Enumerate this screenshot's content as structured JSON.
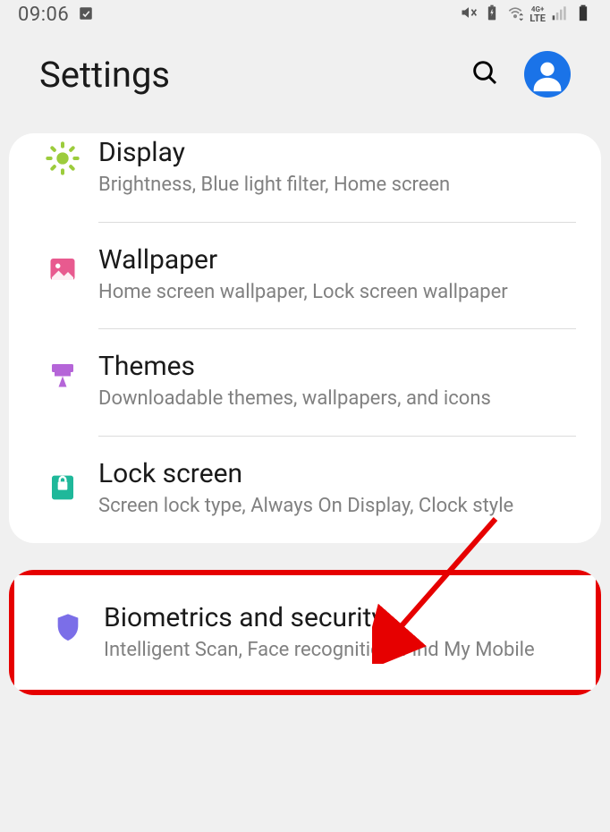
{
  "status": {
    "time": "09:06",
    "lte_label": "LTE"
  },
  "header": {
    "title": "Settings"
  },
  "group1": {
    "display": {
      "title": "Display",
      "sub": "Brightness, Blue light filter, Home screen"
    },
    "wallpaper": {
      "title": "Wallpaper",
      "sub": "Home screen wallpaper, Lock screen wallpaper"
    },
    "themes": {
      "title": "Themes",
      "sub": "Downloadable themes, wallpapers, and icons"
    },
    "lockscreen": {
      "title": "Lock screen",
      "sub": "Screen lock type, Always On Display, Clock style"
    }
  },
  "group2": {
    "biometrics": {
      "title": "Biometrics and security",
      "sub": "Intelligent Scan, Face recognition, Find My Mobile"
    }
  },
  "colors": {
    "display_icon": "#9ccc3c",
    "wallpaper_icon": "#e85a8f",
    "themes_icon": "#b565d8",
    "lock_icon": "#1fb89a",
    "shield_icon": "#7b6ee8"
  }
}
